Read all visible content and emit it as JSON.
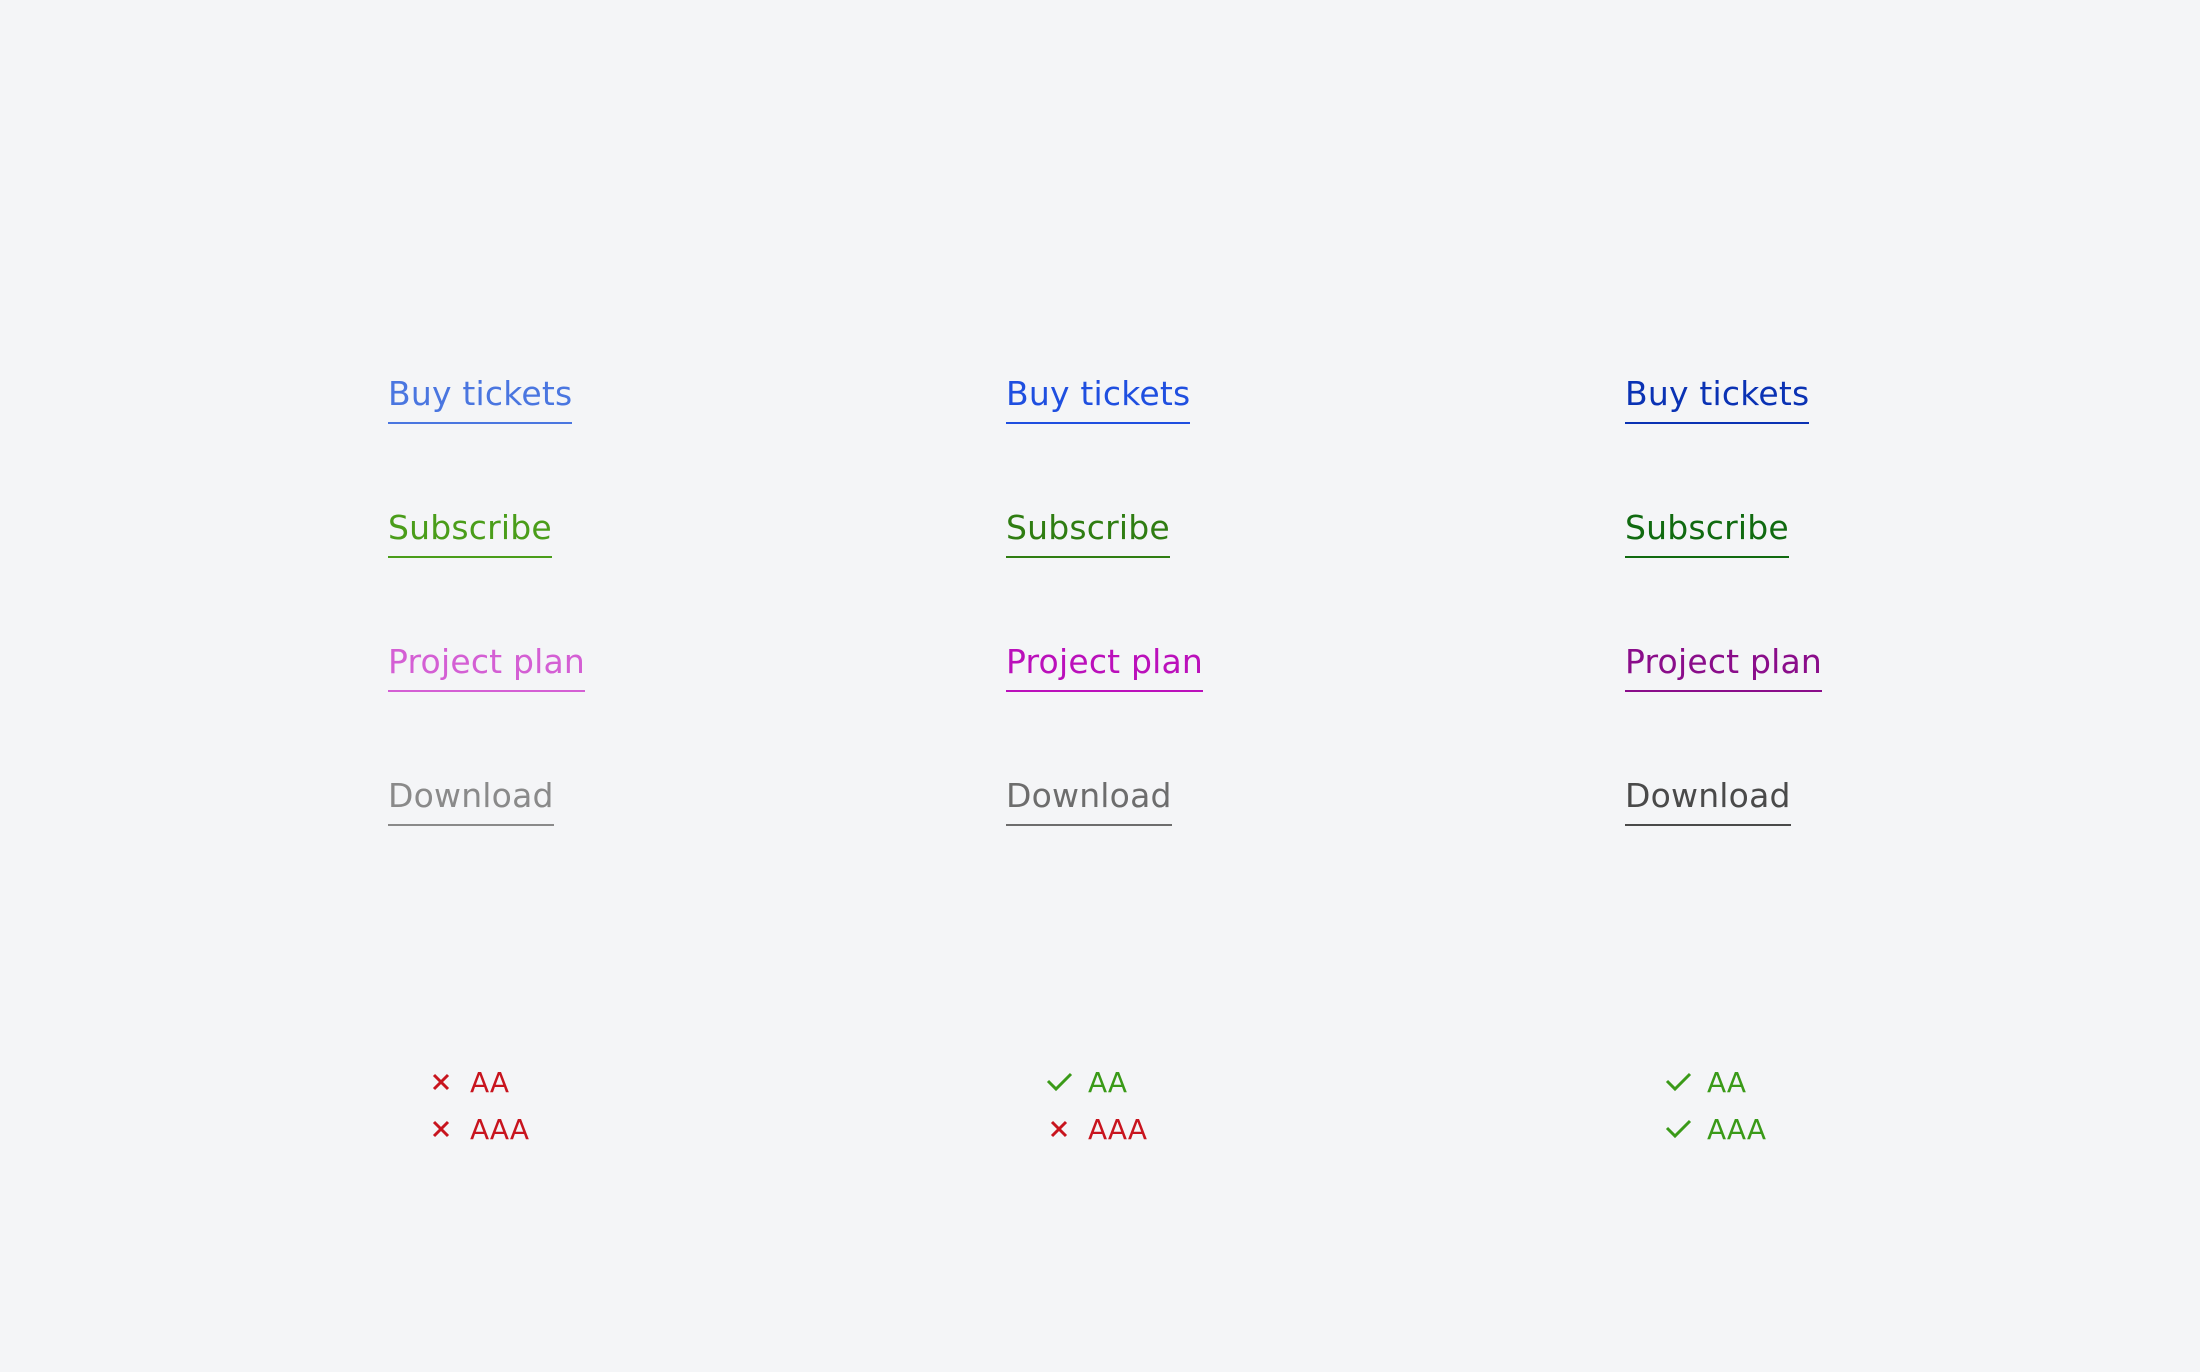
{
  "columns": [
    {
      "links": [
        {
          "label": "Buy tickets",
          "color": "#4a76e0"
        },
        {
          "label": "Subscribe",
          "color": "#4a9d1a"
        },
        {
          "label": "Project plan",
          "color": "#d45fd4"
        },
        {
          "label": "Download",
          "color": "#8a8a8a"
        }
      ],
      "badges": [
        {
          "label": "AA",
          "status": "fail",
          "icon": "cross-icon",
          "color": "#c8141e"
        },
        {
          "label": "AAA",
          "status": "fail",
          "icon": "cross-icon",
          "color": "#c8141e"
        }
      ]
    },
    {
      "links": [
        {
          "label": "Buy tickets",
          "color": "#1f4fe0"
        },
        {
          "label": "Subscribe",
          "color": "#2f7d12"
        },
        {
          "label": "Project plan",
          "color": "#bb10bb"
        },
        {
          "label": "Download",
          "color": "#6d6d6d"
        }
      ],
      "badges": [
        {
          "label": "AA",
          "status": "pass",
          "icon": "check-icon",
          "color": "#3a9a18"
        },
        {
          "label": "AAA",
          "status": "fail",
          "icon": "cross-icon",
          "color": "#c8141e"
        }
      ]
    },
    {
      "links": [
        {
          "label": "Buy tickets",
          "color": "#0a32b4"
        },
        {
          "label": "Subscribe",
          "color": "#106a10"
        },
        {
          "label": "Project plan",
          "color": "#8a0d8a"
        },
        {
          "label": "Download",
          "color": "#4a4a4a"
        }
      ],
      "badges": [
        {
          "label": "AA",
          "status": "pass",
          "icon": "check-icon",
          "color": "#3a9a18"
        },
        {
          "label": "AAA",
          "status": "pass",
          "icon": "check-icon",
          "color": "#3a9a18"
        }
      ]
    }
  ]
}
